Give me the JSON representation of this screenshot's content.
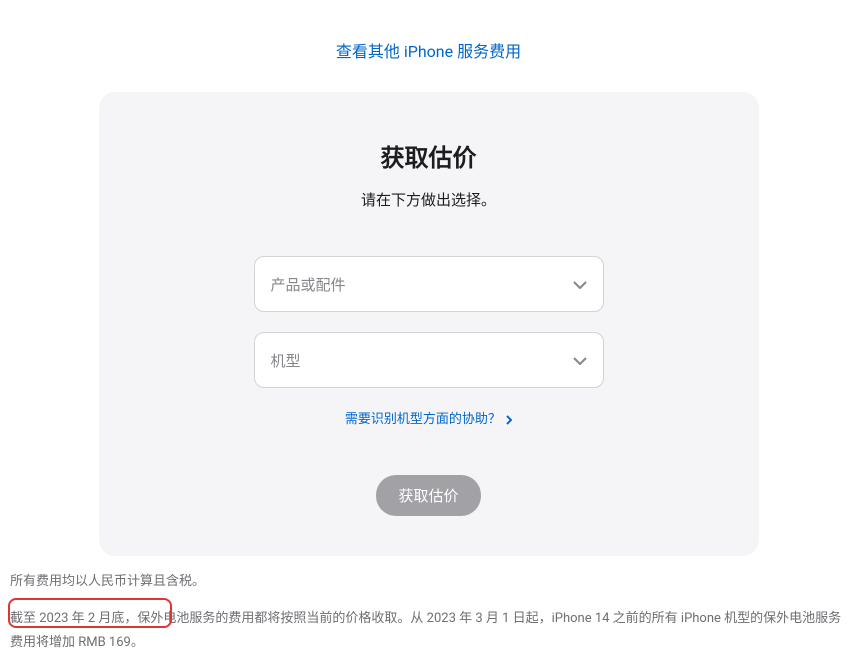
{
  "topLink": {
    "text": "查看其他 iPhone 服务费用"
  },
  "card": {
    "title": "获取估价",
    "subtitle": "请在下方做出选择。",
    "select1": {
      "placeholder": "产品或配件"
    },
    "select2": {
      "placeholder": "机型"
    },
    "helpLink": {
      "text": "需要识别机型方面的协助？"
    },
    "submitButton": {
      "label": "获取估价"
    }
  },
  "footer": {
    "line1": "所有费用均以人民币计算且含税。",
    "line2": "截至 2023 年 2 月底，保外电池服务的费用都将按照当前的价格收取。从 2023 年 3 月 1 日起，iPhone 14 之前的所有 iPhone 机型的保外电池服务费用将增加 RMB 169。"
  }
}
